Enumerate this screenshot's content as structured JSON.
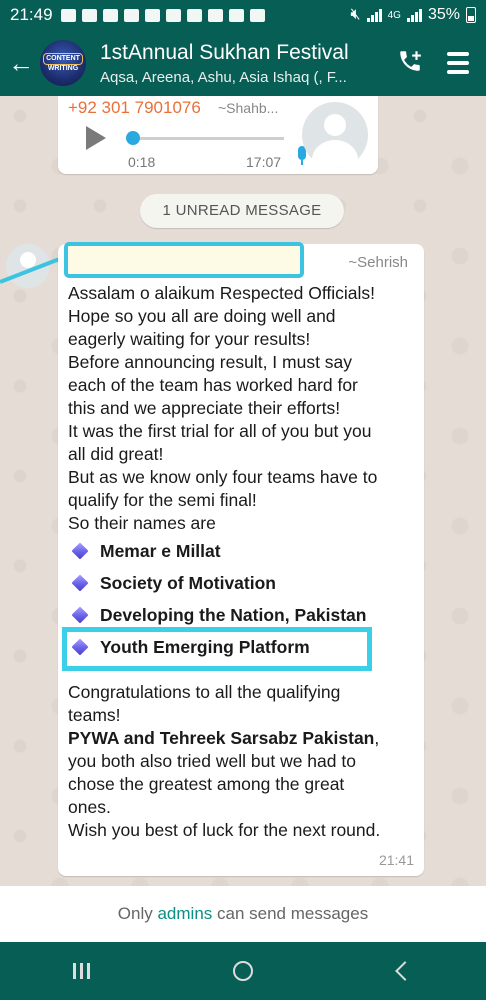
{
  "status_bar": {
    "time": "21:49",
    "network": "4G",
    "battery": "35%"
  },
  "header": {
    "back_icon": "arrow-left-icon",
    "avatar_text_1": "CONTENT",
    "avatar_text_2": "WRITING",
    "title": "1stAnnual Sukhan Festival",
    "subtitle": "Aqsa, Areena, Ashu, Asia Ishaq (, F..."
  },
  "voice_message": {
    "sender": "+92 301 7901076",
    "name": "~Shahb...",
    "duration": "0:18",
    "time": "17:07"
  },
  "unread_banner": "1 UNREAD MESSAGE",
  "message": {
    "sender_name": "~Sehrish",
    "lines_intro": [
      "Assalam o alaikum Respected Officials!",
      "Hope so you all are doing well and",
      "eagerly waiting for your results!",
      "Before announcing result, I must say",
      "each of the team has worked hard for",
      "this and we appreciate their efforts!",
      "It was the first trial for all of you but you",
      "all did great!",
      "But as we know only four teams have to",
      "qualify for the semi final!",
      "So their names are"
    ],
    "teams": [
      "Memar e Millat",
      "Society of Motivation",
      "Developing the Nation, Pakistan",
      "Youth Emerging Platform"
    ],
    "line_congrats_1": "Congratulations to all the qualifying",
    "line_congrats_2": "teams!",
    "line_bold": "PYWA and Tehreek Sarsabz Pakistan",
    "line_bold_suffix": ",",
    "lines_outro": [
      "you both also tried well but we had to",
      "chose the greatest among the great",
      "ones.",
      "Wish you best of luck for the next round."
    ],
    "time": "21:41"
  },
  "footer": {
    "prefix": "Only ",
    "link": "admins",
    "suffix": " can send messages"
  }
}
